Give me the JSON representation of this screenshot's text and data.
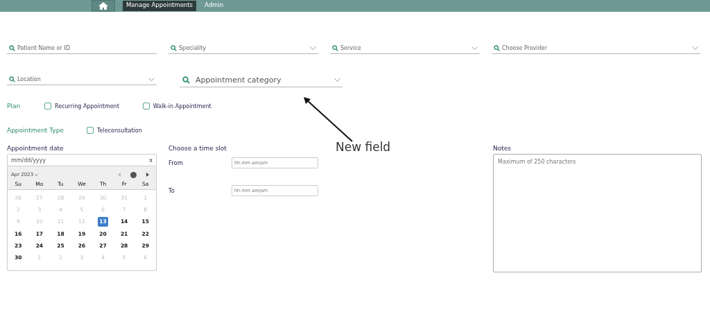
{
  "nav": {
    "items": [
      {
        "label": "Manage Appointments",
        "selected": true
      },
      {
        "label": "Admin",
        "selected": false
      }
    ]
  },
  "filters": [
    {
      "placeholder": "Patient Name or ID",
      "dropdown": false
    },
    {
      "placeholder": "Speciality",
      "dropdown": true
    },
    {
      "placeholder": "Service",
      "dropdown": true
    },
    {
      "placeholder": "Choose Provider",
      "dropdown": true
    },
    {
      "placeholder": "Location",
      "dropdown": true
    }
  ],
  "new_filter": {
    "placeholder": "Appointment category",
    "dropdown": true
  },
  "annotation": {
    "text": "New field"
  },
  "option_groups": [
    {
      "label": "Plan",
      "options": [
        {
          "label": "Recurring Appointment",
          "checked": false
        },
        {
          "label": "Walk-in Appointment",
          "checked": false
        }
      ]
    },
    {
      "label": "Appointment Type",
      "options": [
        {
          "label": "Teleconsultation",
          "checked": false
        }
      ]
    }
  ],
  "date": {
    "label": "Appointment date",
    "placeholder": "mm/dd/yyyy",
    "clear": "x",
    "month": "Apr 2023",
    "weekdays": [
      "Su",
      "Mo",
      "Tu",
      "We",
      "Th",
      "Fr",
      "Sa"
    ],
    "weeks": [
      [
        {
          "day": "26",
          "outside": true,
          "selected": false
        },
        {
          "day": "27",
          "outside": true,
          "selected": false
        },
        {
          "day": "28",
          "outside": true,
          "selected": false
        },
        {
          "day": "29",
          "outside": true,
          "selected": false
        },
        {
          "day": "30",
          "outside": true,
          "selected": false
        },
        {
          "day": "31",
          "outside": true,
          "selected": false
        },
        {
          "day": "1",
          "outside": true,
          "selected": false
        }
      ],
      [
        {
          "day": "2",
          "outside": true,
          "selected": false
        },
        {
          "day": "3",
          "outside": true,
          "selected": false
        },
        {
          "day": "4",
          "outside": true,
          "selected": false
        },
        {
          "day": "5",
          "outside": true,
          "selected": false
        },
        {
          "day": "6",
          "outside": true,
          "selected": false
        },
        {
          "day": "7",
          "outside": true,
          "selected": false
        },
        {
          "day": "8",
          "outside": true,
          "selected": false
        }
      ],
      [
        {
          "day": "9",
          "outside": true,
          "selected": false
        },
        {
          "day": "10",
          "outside": true,
          "selected": false
        },
        {
          "day": "11",
          "outside": true,
          "selected": false
        },
        {
          "day": "12",
          "outside": true,
          "selected": false
        },
        {
          "day": "13",
          "outside": false,
          "selected": true
        },
        {
          "day": "14",
          "outside": false,
          "selected": false
        },
        {
          "day": "15",
          "outside": false,
          "selected": false
        }
      ],
      [
        {
          "day": "16",
          "outside": false,
          "selected": false
        },
        {
          "day": "17",
          "outside": false,
          "selected": false
        },
        {
          "day": "18",
          "outside": false,
          "selected": false
        },
        {
          "day": "19",
          "outside": false,
          "selected": false
        },
        {
          "day": "20",
          "outside": false,
          "selected": false
        },
        {
          "day": "21",
          "outside": false,
          "selected": false
        },
        {
          "day": "22",
          "outside": false,
          "selected": false
        }
      ],
      [
        {
          "day": "23",
          "outside": false,
          "selected": false
        },
        {
          "day": "24",
          "outside": false,
          "selected": false
        },
        {
          "day": "25",
          "outside": false,
          "selected": false
        },
        {
          "day": "26",
          "outside": false,
          "selected": false
        },
        {
          "day": "27",
          "outside": false,
          "selected": false
        },
        {
          "day": "28",
          "outside": false,
          "selected": false
        },
        {
          "day": "29",
          "outside": false,
          "selected": false
        }
      ],
      [
        {
          "day": "30",
          "outside": false,
          "selected": false
        },
        {
          "day": "1",
          "outside": true,
          "selected": false
        },
        {
          "day": "2",
          "outside": true,
          "selected": false
        },
        {
          "day": "3",
          "outside": true,
          "selected": false
        },
        {
          "day": "4",
          "outside": true,
          "selected": false
        },
        {
          "day": "5",
          "outside": true,
          "selected": false
        },
        {
          "day": "6",
          "outside": true,
          "selected": false
        }
      ]
    ]
  },
  "time_slot": {
    "label": "Choose a time slot",
    "fields": [
      {
        "label": "From",
        "placeholder": "hh:mm am/pm"
      },
      {
        "label": "To",
        "placeholder": "hh:mm am/pm"
      }
    ]
  },
  "notes": {
    "label": "Notes",
    "placeholder": "Maximum of 250 characters"
  }
}
